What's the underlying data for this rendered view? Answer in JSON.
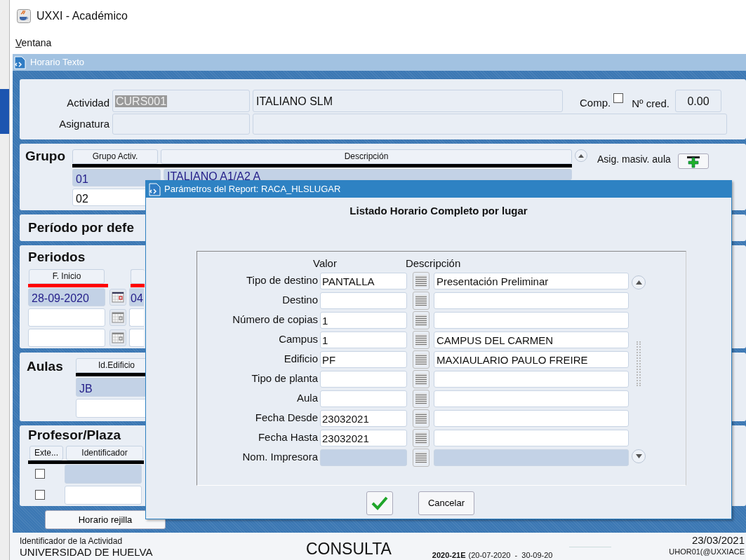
{
  "app_window": {
    "title": "UXXI - Académico"
  },
  "menu": [
    {
      "label": "Ventana"
    }
  ],
  "form": {
    "title": "Horario Texto",
    "actividad": {
      "label": "Actividad",
      "code": "CURS001",
      "code_selected": true,
      "name": "ITALIANO SLM",
      "comp_label": "Comp.",
      "comp_checked": false,
      "cred_label": "Nº cred.",
      "cred": "0.00"
    },
    "asignatura": {
      "label": "Asignatura"
    },
    "grupo": {
      "title": "Grupo",
      "columns": [
        "Grupo Activ.",
        "Descripción"
      ],
      "mass_label": "Asig. masiv. aula",
      "rows": [
        {
          "code": "01",
          "description": "ITALIANO A1/A2 A",
          "selected": true
        },
        {
          "code": "02",
          "selected": false
        }
      ]
    },
    "periodo_defecto": {
      "title": "Período por defe"
    },
    "periodos": {
      "title": "Periodos",
      "columns": [
        "F. Inicio"
      ],
      "rows": [
        {
          "start": "28-09-2020",
          "column_2": "04",
          "selected": true
        },
        {
          "selected": false
        },
        {
          "selected": false
        }
      ]
    },
    "aulas": {
      "title": "Aulas",
      "columns": [
        "Id.Edificio"
      ],
      "rows": [
        {
          "building": "JB",
          "selected": true
        },
        {
          "selected": false
        }
      ]
    },
    "profesor": {
      "title": "Profesor/Plaza",
      "columns": [
        "Exte...",
        "Identificador"
      ],
      "rows": [
        {
          "external": false,
          "selected": true
        },
        {
          "external": false,
          "selected": false
        }
      ]
    },
    "buttons": [
      "Horario rejilla"
    ]
  },
  "dialog": {
    "title": "Parámetros del Report: RACA_HLSLUGAR",
    "heading": "Listado Horario Completo por lugar",
    "columns": [
      "Valor",
      "Descripción"
    ],
    "params": [
      {
        "label": "Tipo de destino",
        "value": "PANTALLA",
        "description": "Presentación Preliminar",
        "disabled": false
      },
      {
        "label": "Destino",
        "disabled": false
      },
      {
        "label": "Número de copias",
        "value": "1",
        "disabled": false
      },
      {
        "label": "Campus",
        "value": "1",
        "description": "CAMPUS DEL CARMEN",
        "disabled": false
      },
      {
        "label": "Edificio",
        "value": "PF",
        "description": "MAXIAULARIO PAULO FREIRE",
        "disabled": false
      },
      {
        "label": "Tipo de planta",
        "disabled": false
      },
      {
        "label": "Aula",
        "disabled": false
      },
      {
        "label": "Fecha Desde",
        "value": "23032021",
        "disabled": false
      },
      {
        "label": "Fecha Hasta",
        "value": "23032021",
        "disabled": false
      },
      {
        "label": "Nom. Impresora",
        "disabled": true
      }
    ],
    "buttons": [
      {
        "kind": "ok"
      },
      {
        "kind": "cancel",
        "label": "Cancelar"
      }
    ]
  },
  "status_bar": {
    "field_hint": "Identificador de la Actividad",
    "institution": "UNIVERSIDAD DE HUELVA",
    "mode": "CONSULTA",
    "period": "2020-21E",
    "period_range": "(20-07-2020  -  30-09-20",
    "date": "23/03/2021",
    "user": "UHOR01(@UXXIACE"
  }
}
